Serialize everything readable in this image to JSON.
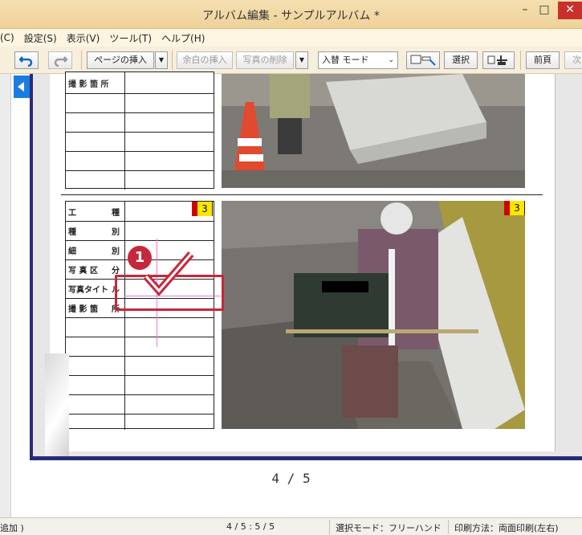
{
  "window": {
    "title": "アルバム編集 - サンプルアルバム *",
    "minimize": "–",
    "maximize": "□",
    "close": "✕"
  },
  "menu": [
    "(C)",
    "設定(S)",
    "表示(V)",
    "ツール(T)",
    "ヘルプ(H)"
  ],
  "toolbar": {
    "undo_icon": "undo-icon",
    "redo_icon": "redo-icon",
    "insert_page": "ページの挿入",
    "insert_blank": "余白の挿入",
    "delete_photo": "写真の削除",
    "mode_select": "入替 モード",
    "select_label": "選択",
    "prev_page": "前頁",
    "next_page": "次頁"
  },
  "top_table": {
    "partial_label": "撮 影 箇 所",
    "rows": 6
  },
  "bottom_table": {
    "badge": "3",
    "rows": [
      {
        "left": "工",
        "right": "種"
      },
      {
        "left": "種",
        "right": "別"
      },
      {
        "left": "細",
        "right": "別"
      },
      {
        "left": "写 真 区",
        "right": "分"
      },
      {
        "left": "写真タイト",
        "right": "ル"
      },
      {
        "left": "撮 影 箇",
        "right": "所"
      }
    ]
  },
  "photos": {
    "top_badge": "",
    "bottom_badge": "3"
  },
  "annotation": {
    "number": "1"
  },
  "page_counter": "4 / 5",
  "status": {
    "left": "追加 )",
    "pages": "4 / 5 : 5 / 5",
    "selection_mode": "選択モード：フリーハンド",
    "print_mode": "印刷方法：両面印刷(左右)"
  },
  "colors": {
    "titlebar": "#efd29a",
    "accent_red": "#c6283a",
    "badge_yellow": "#ffe600",
    "page_border": "#2a2a7a"
  }
}
